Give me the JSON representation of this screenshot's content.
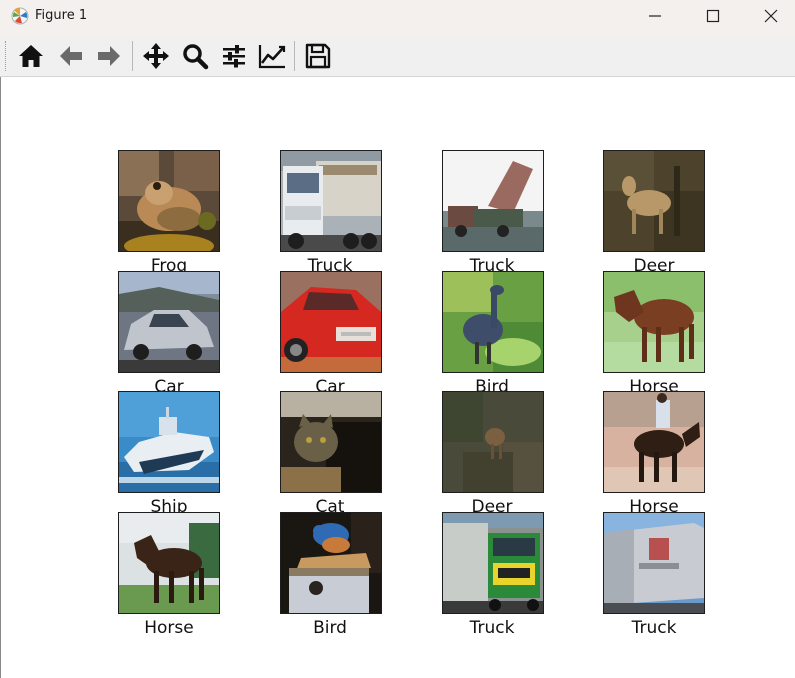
{
  "window": {
    "title": "Figure 1",
    "controls": {
      "minimize": "minimize-icon",
      "maximize": "maximize-icon",
      "close": "close-icon"
    }
  },
  "toolbar": {
    "tools": [
      {
        "name": "home",
        "icon": "home-icon"
      },
      {
        "name": "back",
        "icon": "arrow-left-icon"
      },
      {
        "name": "forward",
        "icon": "arrow-right-icon"
      },
      {
        "name": "pan",
        "icon": "move-icon"
      },
      {
        "name": "zoom",
        "icon": "magnifier-icon"
      },
      {
        "name": "configure-subplots",
        "icon": "sliders-icon"
      },
      {
        "name": "edit-axes",
        "icon": "line-chart-icon"
      },
      {
        "name": "save",
        "icon": "floppy-disk-icon"
      }
    ]
  },
  "figure": {
    "images": [
      {
        "label": "Frog"
      },
      {
        "label": "Truck"
      },
      {
        "label": "Truck"
      },
      {
        "label": "Deer"
      },
      {
        "label": "Car"
      },
      {
        "label": "Car"
      },
      {
        "label": "Bird"
      },
      {
        "label": "Horse"
      },
      {
        "label": "Ship"
      },
      {
        "label": "Cat"
      },
      {
        "label": "Deer"
      },
      {
        "label": "Horse"
      },
      {
        "label": "Horse"
      },
      {
        "label": "Bird"
      },
      {
        "label": "Truck"
      },
      {
        "label": "Truck"
      }
    ]
  }
}
